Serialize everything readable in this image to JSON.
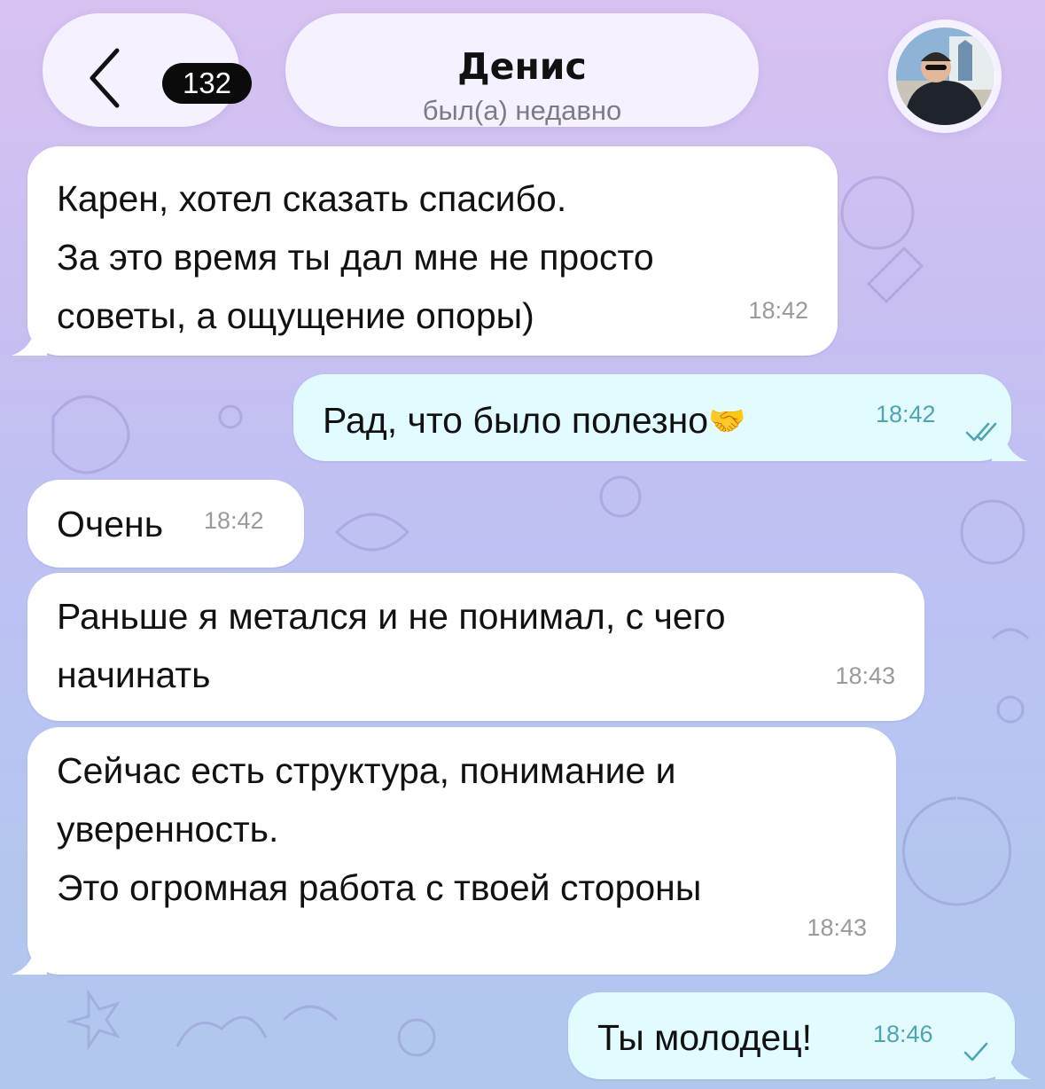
{
  "header": {
    "back_count": "132",
    "contact_name": "Денис",
    "contact_status": "был(а) недавно"
  },
  "messages": [
    {
      "direction": "in",
      "text": "Карен, хотел сказать спасибо.\nЗа это время ты дал мне не просто\nсоветы, а ощущение опоры)",
      "time": "18:42"
    },
    {
      "direction": "out",
      "text": "Рад, что было полезно",
      "emoji": "🤝",
      "time": "18:42",
      "status": "read"
    },
    {
      "direction": "in",
      "text": "Очень",
      "time": "18:42"
    },
    {
      "direction": "in",
      "text": "Раньше я метался и не понимал, с чего\nначинать",
      "time": "18:43"
    },
    {
      "direction": "in",
      "text": "Сейчас есть структура, понимание и\nуверенность.\nЭто огромная работа с твоей стороны",
      "time": "18:43"
    },
    {
      "direction": "out",
      "text": "Ты молодец!",
      "time": "18:46",
      "status": "sent"
    }
  ],
  "colors": {
    "incoming_bubble": "#ffffff",
    "outgoing_bubble": "#e2fbff",
    "outgoing_time": "#4fa4b2",
    "badge": "#0b0b0b"
  }
}
